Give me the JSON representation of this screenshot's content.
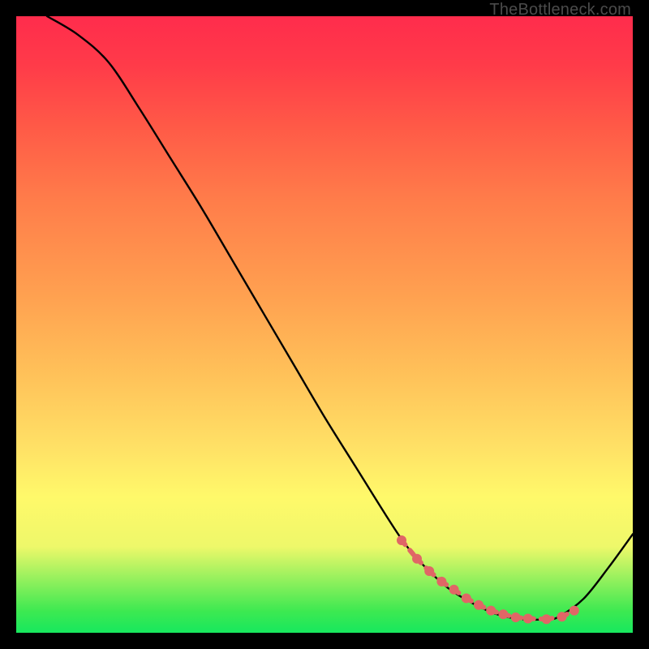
{
  "watermark": "TheBottleneck.com",
  "chart_data": {
    "type": "line",
    "title": "",
    "xlabel": "",
    "ylabel": "",
    "xlim": [
      0,
      100
    ],
    "ylim": [
      0,
      100
    ],
    "series": [
      {
        "name": "curve",
        "x": [
          5,
          10,
          15,
          20,
          25,
          30,
          35,
          40,
          45,
          50,
          55,
          60,
          63,
          66,
          70,
          74,
          78,
          82,
          86,
          88,
          92,
          96,
          100
        ],
        "y": [
          100,
          97,
          92.5,
          85,
          77,
          69,
          60.5,
          52,
          43.5,
          35,
          27,
          19,
          14.5,
          11,
          7.3,
          4.8,
          3,
          2.2,
          2.2,
          2.6,
          5.5,
          10.5,
          16
        ]
      }
    ],
    "markers": {
      "name": "highlight-dots",
      "color": "#e06666",
      "x": [
        62.5,
        65,
        67,
        69,
        71,
        73,
        75,
        77,
        79,
        81,
        83,
        86,
        88.5,
        90.5
      ],
      "y": [
        15,
        12,
        10,
        8.3,
        7,
        5.6,
        4.5,
        3.6,
        3,
        2.5,
        2.3,
        2.2,
        2.6,
        3.6
      ]
    }
  }
}
